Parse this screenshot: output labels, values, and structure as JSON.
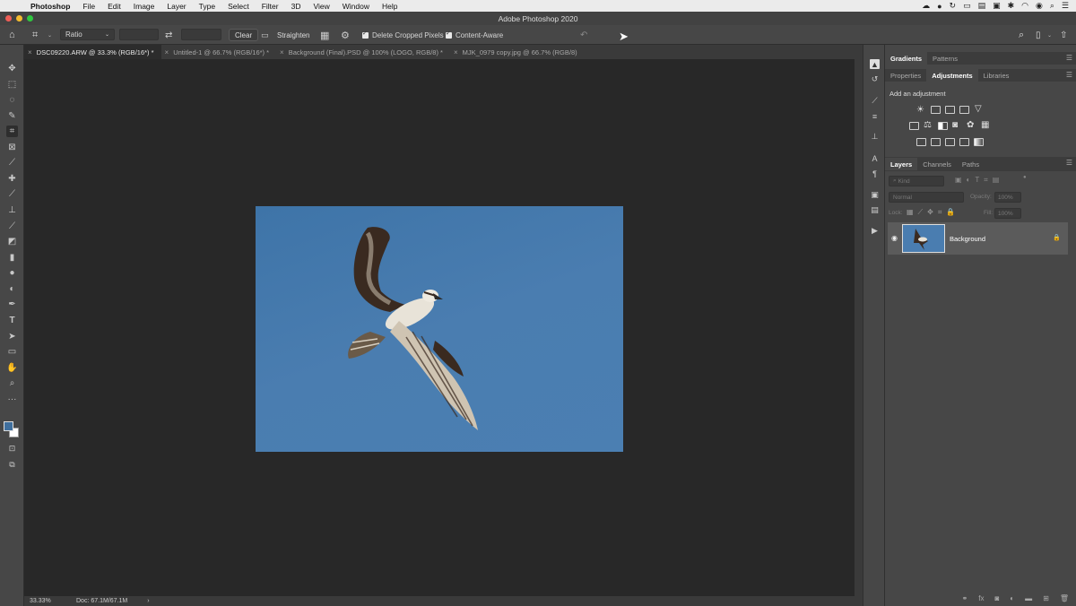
{
  "menubar": {
    "app": "Photoshop",
    "items": [
      "File",
      "Edit",
      "Image",
      "Layer",
      "Type",
      "Select",
      "Filter",
      "3D",
      "View",
      "Window",
      "Help"
    ]
  },
  "window": {
    "title": "Adobe Photoshop 2020"
  },
  "options": {
    "ratio": "Ratio",
    "clear": "Clear",
    "straighten": "Straighten",
    "delete_cropped": "Delete Cropped Pixels",
    "content_aware": "Content-Aware"
  },
  "tabs": [
    {
      "label": "DSC09220.ARW @ 33.3% (RGB/16*) *",
      "active": true
    },
    {
      "label": "Untitled-1 @ 66.7% (RGB/16*) *",
      "active": false
    },
    {
      "label": "Background (Final).PSD @ 100% (LOGO, RGB/8) *",
      "active": false
    },
    {
      "label": "MJK_0979 copy.jpg @ 66.7% (RGB/8)",
      "active": false
    }
  ],
  "status": {
    "zoom": "33.33%",
    "doc": "Doc: 67.1M/67.1M",
    "arrow": "›"
  },
  "panels": {
    "top_tabs": [
      "Gradients",
      "Patterns"
    ],
    "mid_tabs": [
      "Properties",
      "Adjustments",
      "Libraries"
    ],
    "add_adjustment": "Add an adjustment",
    "layer_tabs": [
      "Layers",
      "Channels",
      "Paths"
    ],
    "kind_placeholder": "Kind",
    "blend_mode": "Normal",
    "opacity_label": "Opacity:",
    "opacity_value": "100%",
    "lock_label": "Lock:",
    "fill_label": "Fill:",
    "fill_value": "100%",
    "layer_name": "Background"
  },
  "colors": {
    "foreground": "#3f6f9e",
    "background": "#ffffff",
    "sky": "#4a7db0"
  }
}
